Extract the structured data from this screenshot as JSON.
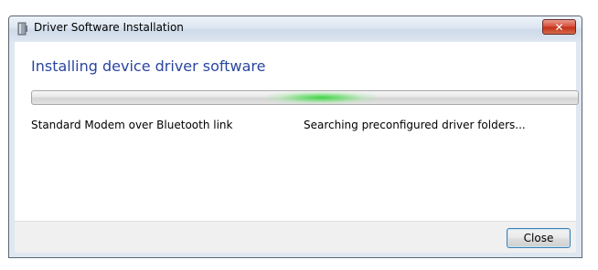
{
  "window": {
    "title": "Driver Software Installation",
    "title_icon": "device-icon",
    "close_glyph": "✕"
  },
  "main": {
    "heading": "Installing device driver software",
    "device_name": "Standard Modem over Bluetooth link",
    "status_text": "Searching preconfigured driver folders...",
    "progress": {
      "mode": "indeterminate",
      "glow_position": 0.53,
      "glow_width": 0.2
    }
  },
  "footer": {
    "close_label": "Close"
  },
  "colors": {
    "heading": "#2a46a0",
    "progress_glow": "#38d23e",
    "close_button_red": "#c23217"
  }
}
